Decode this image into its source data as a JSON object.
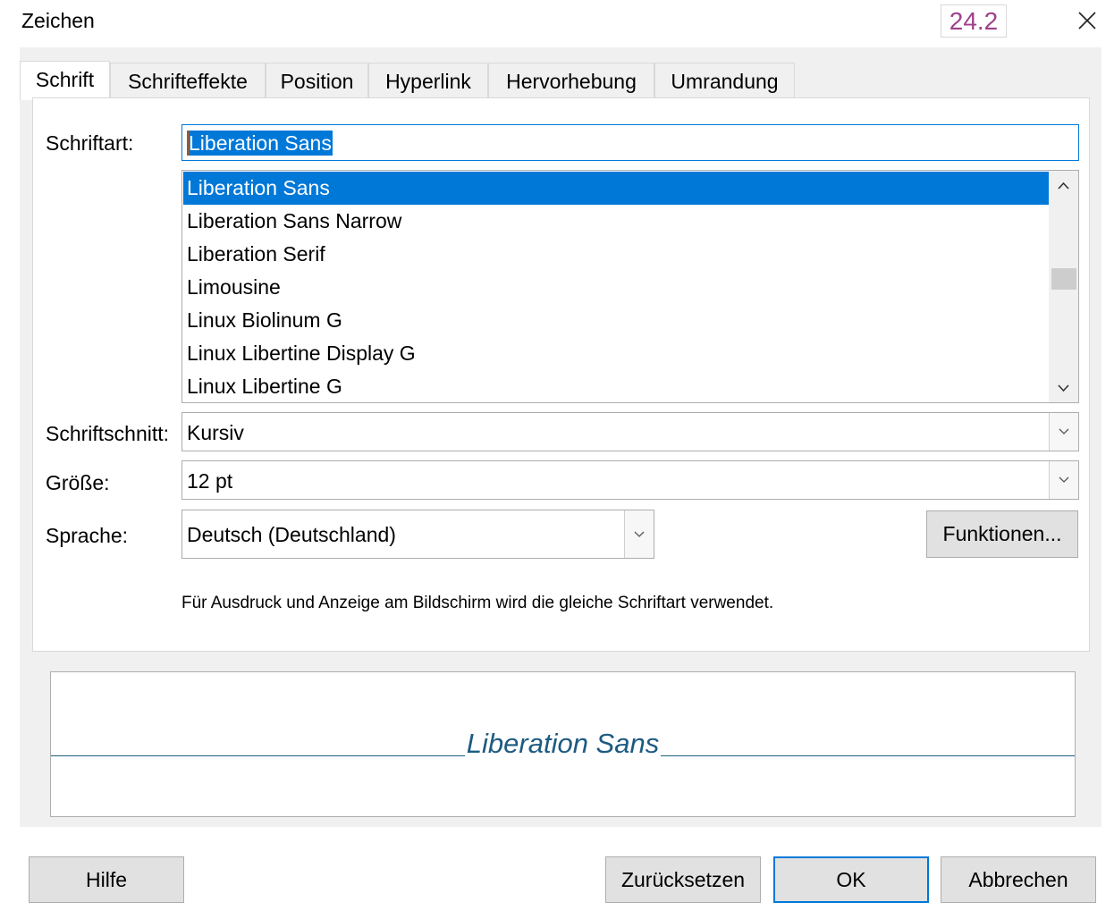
{
  "window": {
    "title": "Zeichen",
    "version_badge": "24.2",
    "close_icon": "close-icon"
  },
  "tabs": [
    {
      "label": "Schrift",
      "active": true
    },
    {
      "label": "Schrifteffekte",
      "active": false
    },
    {
      "label": "Position",
      "active": false
    },
    {
      "label": "Hyperlink",
      "active": false
    },
    {
      "label": "Hervorhebung",
      "active": false
    },
    {
      "label": "Umrandung",
      "active": false
    }
  ],
  "font": {
    "label": "Schriftart:",
    "value": "Liberation Sans",
    "list": [
      "Liberation Sans",
      "Liberation Sans Narrow",
      "Liberation Serif",
      "Limousine",
      "Linux Biolinum G",
      "Linux Libertine Display G",
      "Linux Libertine G"
    ],
    "selected_index": 0
  },
  "style": {
    "label": "Schriftschnitt:",
    "value": "Kursiv"
  },
  "size": {
    "label": "Größe:",
    "value": "12 pt"
  },
  "language": {
    "label": "Sprache:",
    "value": "Deutsch (Deutschland)"
  },
  "features_button": "Funktionen...",
  "hint_text": "Für Ausdruck und Anzeige am Bildschirm wird die gleiche Schriftart verwendet.",
  "preview": {
    "sample_text": "Liberation Sans",
    "text_color": "#1c5a82"
  },
  "footer": {
    "help": "Hilfe",
    "reset": "Zurücksetzen",
    "ok": "OK",
    "cancel": "Abbrechen"
  },
  "colors": {
    "selection": "#0078d7",
    "badge": "#a0408a"
  }
}
